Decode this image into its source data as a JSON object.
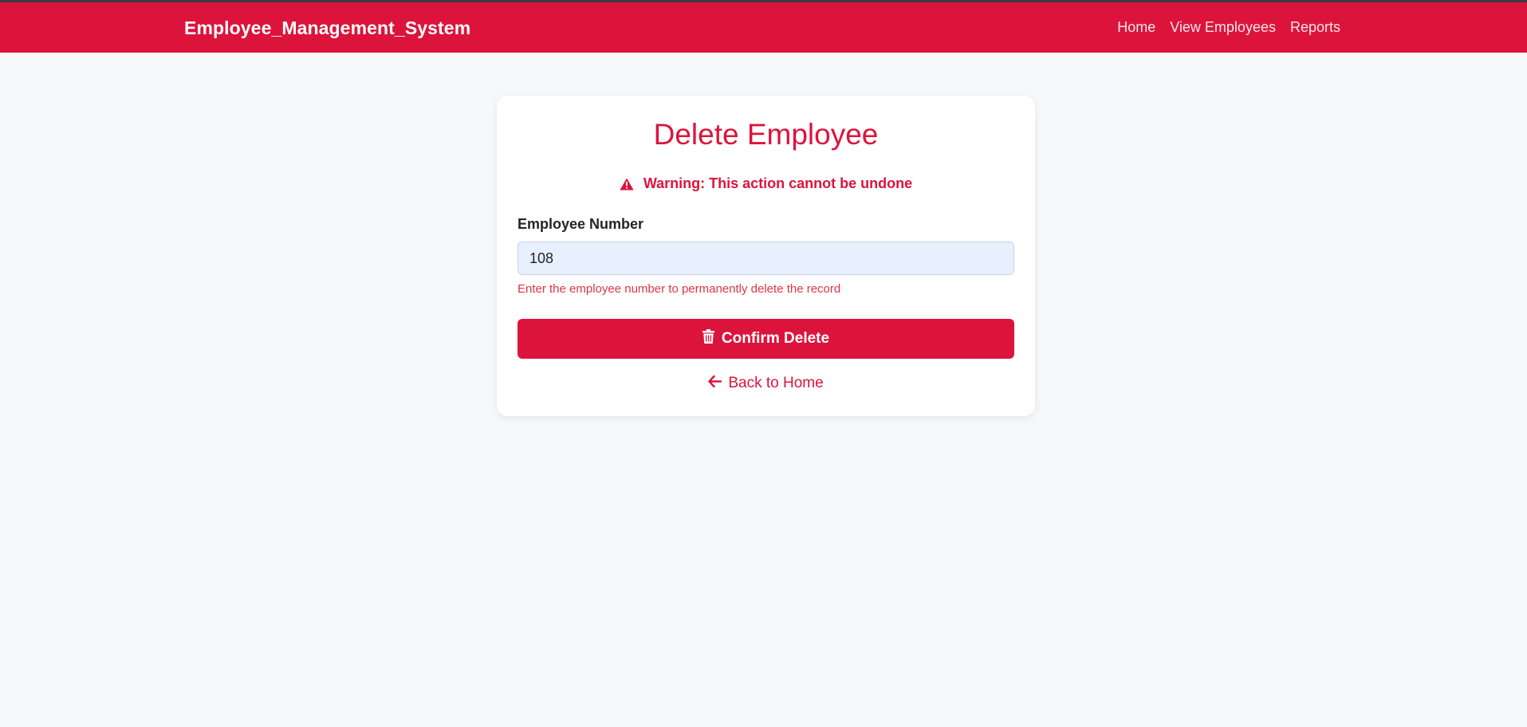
{
  "navbar": {
    "brand": "Employee_Management_System",
    "links": [
      "Home",
      "View Employees",
      "Reports"
    ],
    "color": "#dc143c"
  },
  "card": {
    "title": "Delete Employee",
    "warning": {
      "icon": "warning-triangle-icon",
      "text": "Warning: This action cannot be undone"
    },
    "field": {
      "label": "Employee Number",
      "value": "108",
      "help": "Enter the employee number to permanently delete the record"
    },
    "confirm": {
      "icon": "trash-icon",
      "label": "Confirm Delete"
    },
    "back": {
      "icon": "arrow-left-icon",
      "label": "Back to Home"
    }
  }
}
